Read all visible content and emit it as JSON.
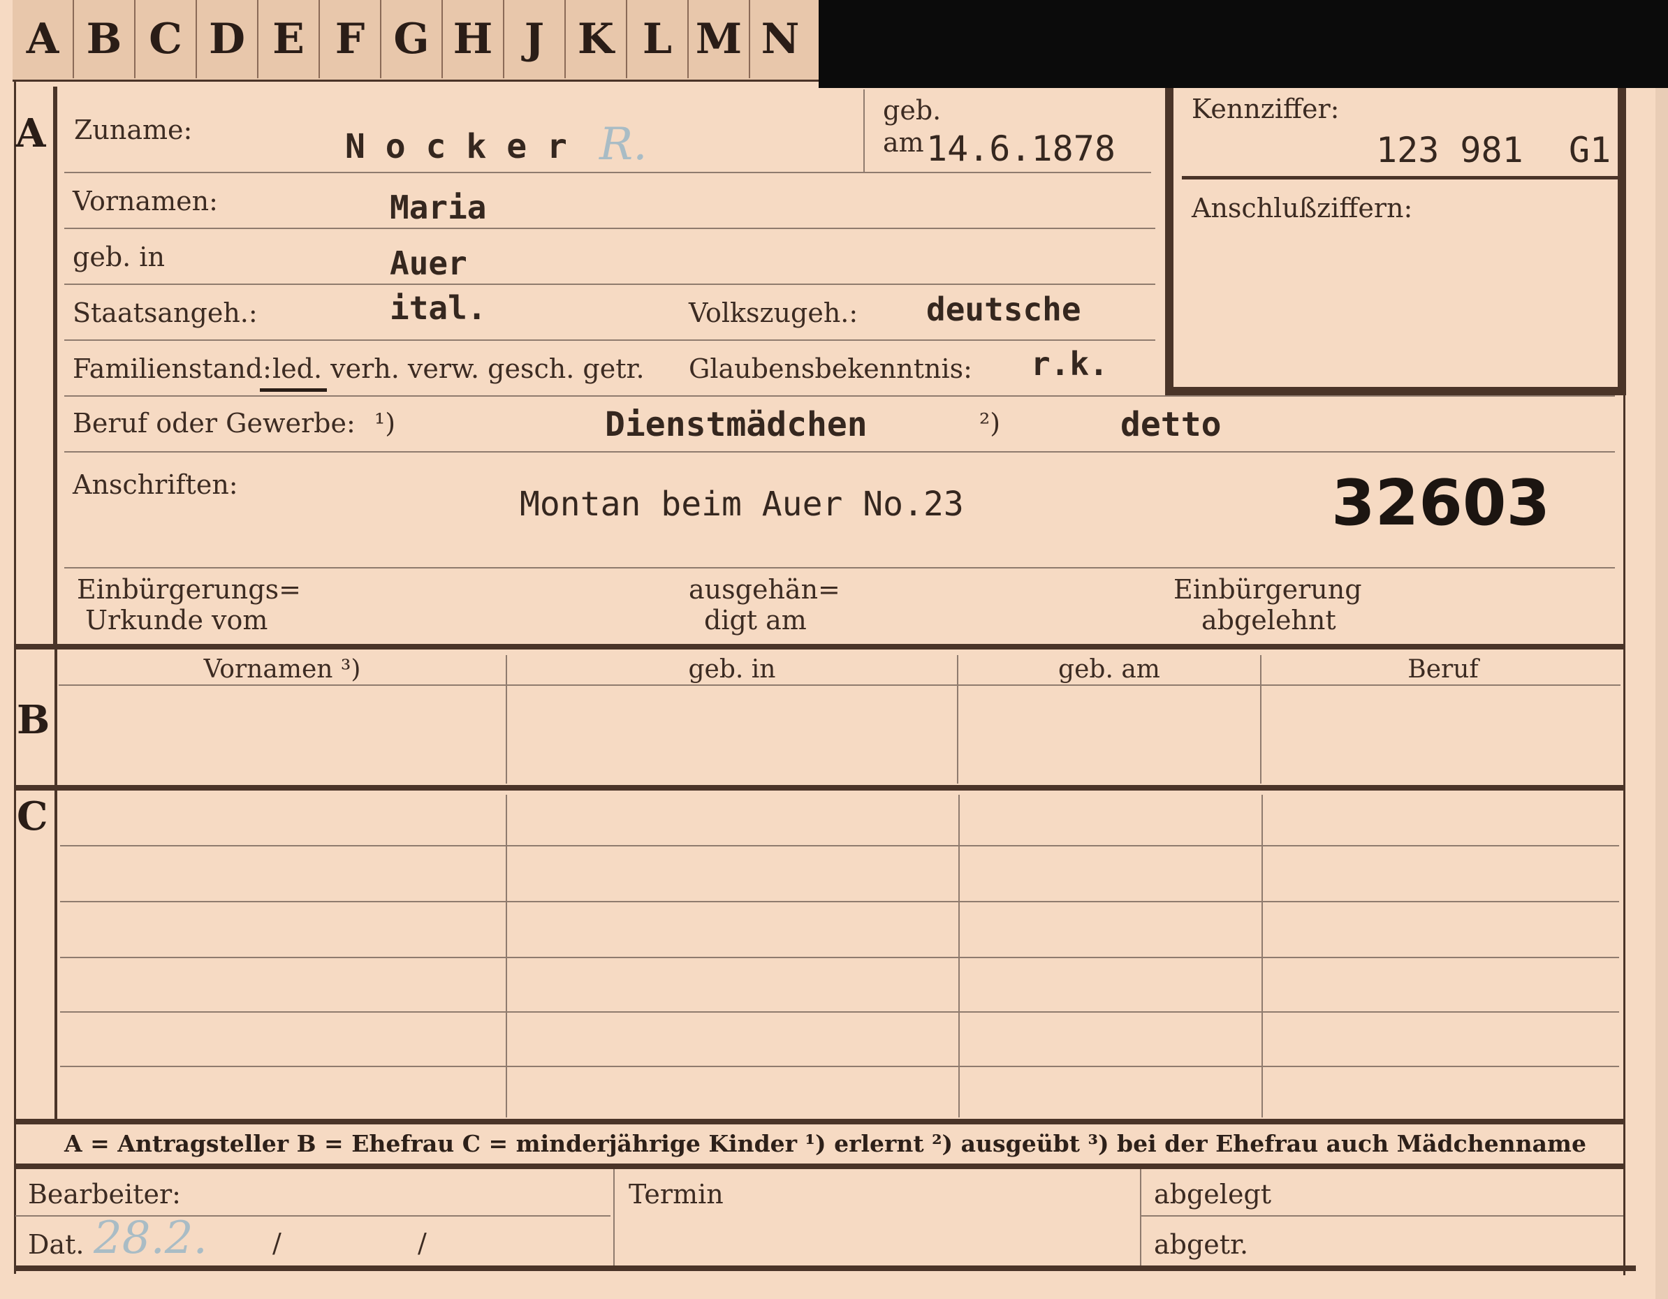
{
  "tabs": [
    "A",
    "B",
    "C",
    "D",
    "E",
    "F",
    "G",
    "H",
    "J",
    "K",
    "L",
    "M",
    "N"
  ],
  "sections": {
    "a": "A",
    "b": "B",
    "c": "C"
  },
  "a": {
    "zuname_label": "Zuname:",
    "zuname_value": "N o c k e r",
    "zuname_hand": "R.",
    "geb_label": "geb.",
    "am_label": "am",
    "geb_date": "14.6.1878",
    "vornamen_label": "Vornamen:",
    "vornamen_value": "Maria",
    "gebin_label": "geb. in",
    "gebin_value": "Auer",
    "staats_label": "Staatsangeh.:",
    "staats_value": "ital.",
    "volks_label": "Volkszugeh.:",
    "volks_value": "deutsche",
    "famstand_label": "Familienstand:",
    "famstand_options": "led. verh. verw. gesch. getr.",
    "glauben_label": "Glaubensbekenntnis:",
    "glauben_value": "r.k.",
    "beruf_label": "Beruf oder Gewerbe:",
    "beruf_mark1": "¹)",
    "beruf_value1": "Dienstmädchen",
    "beruf_mark2": "²)",
    "beruf_value2": "detto",
    "anschrift_label": "Anschriften:",
    "anschrift_value": "Montan beim Auer No.23",
    "file_number": "32603",
    "einb_urkunde_l1": "Einbürgerungs=",
    "einb_urkunde_l2": "Urkunde vom",
    "ausgeh_l1": "ausgehän=",
    "ausgeh_l2": "digt am",
    "abgelehnt_l1": "Einbürgerung",
    "abgelehnt_l2": "abgelehnt"
  },
  "kenn": {
    "label": "Kennziffer:",
    "value": "123 981",
    "suffix": "G1",
    "anschluss_label": "Anschlußziffern:"
  },
  "b": {
    "columns": [
      "Vornamen ³)",
      "geb. in",
      "geb. am",
      "Beruf"
    ]
  },
  "legend": {
    "text": "A = Antragsteller    B = Ehefrau    C = minderjährige Kinder    ¹) erlernt    ²) ausgeübt    ³) bei der Ehefrau auch Mädchenname"
  },
  "footer": {
    "bearbeiter_label": "Bearbeiter:",
    "dat_label": "Dat.",
    "dat_hand": "28.2.",
    "slash1": "/",
    "slash2": "/",
    "termin_label": "Termin",
    "abgelegt_label": "abgelegt",
    "abgetr_label": "abgetr."
  },
  "colors": {
    "paper": "#f6dac3",
    "ink": "#3c2b22",
    "rule": "#4a3428",
    "pencil": "#a9bcc5"
  }
}
